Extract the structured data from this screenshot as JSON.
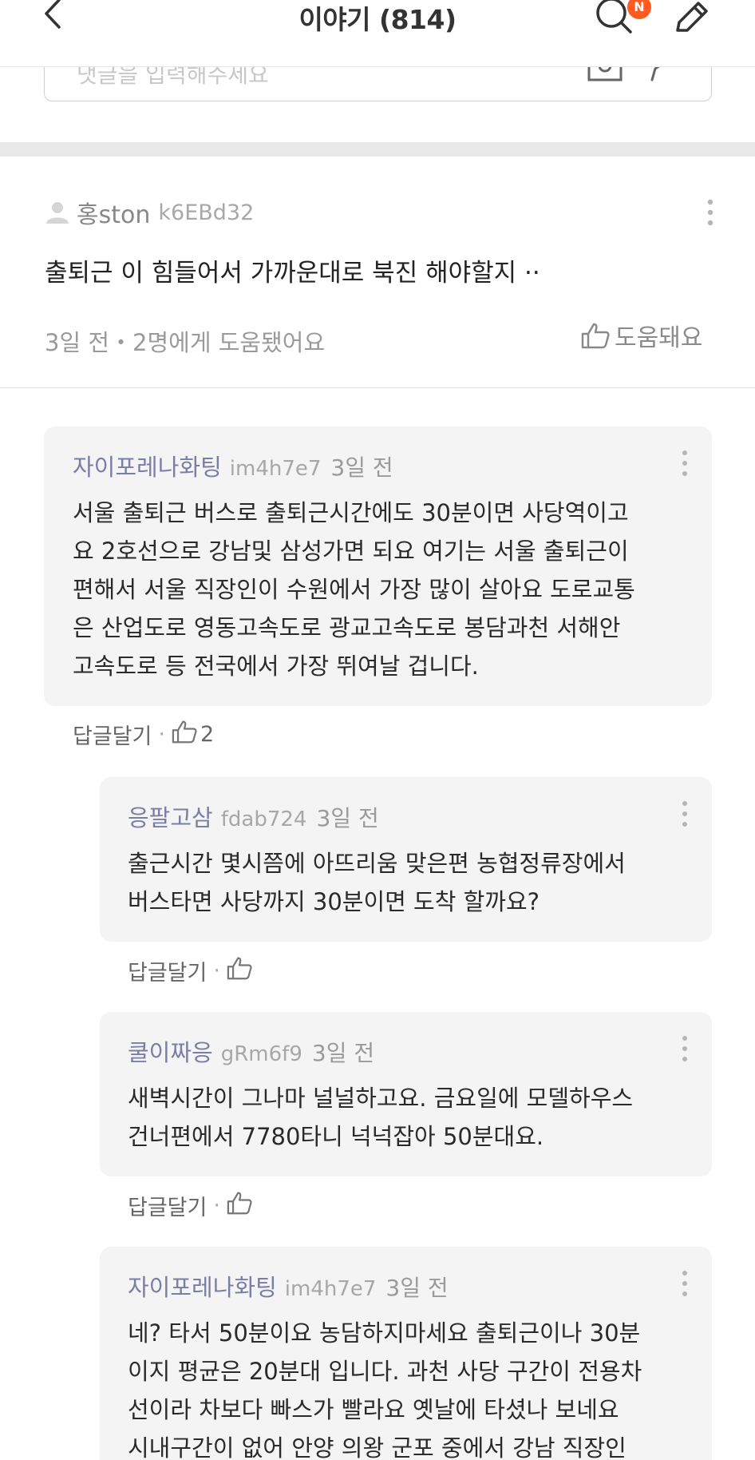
{
  "header": {
    "title": "이야기 (814)",
    "notification_badge": "N",
    "back_icon": "chevron-left-icon",
    "search_icon": "search-icon",
    "write_icon": "pencil-icon"
  },
  "comment_input": {
    "placeholder": "댓글을 입력해주세요"
  },
  "post": {
    "author": "홍ston",
    "user_id": "k6EBd32",
    "body": "출퇴근 이 힘들어서 가까운대로 북진 해야할지 ··",
    "footer": "3일 전・2명에게 도움됐어요",
    "helpful_label": "도움돼요"
  },
  "comments": [
    {
      "author": "자이포레나화팅",
      "user_id": "im4h7e7",
      "time": "3일 전",
      "lines": [
        "서울 출퇴근 버스로 출퇴근시간에도 30분이면 사당역이고",
        "요 2호선으로 강남및 삼성가면 되요 여기는 서울 출퇴근이",
        "편해서 서울 직장인이 수원에서 가장 많이 살아요 도로교통",
        "은 산업도로 영동고속도로 광교고속도로 봉담과천 서해안",
        "고속도로 등 전국에서 가장 뛰여날 겁니다."
      ],
      "reply_label": "답글달기",
      "likes": "2"
    },
    {
      "author": "응팔고삼",
      "user_id": "fdab724",
      "time": "3일 전",
      "lines": [
        "출근시간 몇시쯤에 아뜨리움 맞은편 농협정류장에서",
        "버스타면 사당까지 30분이면 도착 할까요?"
      ],
      "reply_label": "답글달기",
      "likes": ""
    },
    {
      "author": "쿨이짜응",
      "user_id": "gRm6f9",
      "time": "3일 전",
      "lines": [
        "새벽시간이 그나마 널널하고요. 금요일에 모델하우스",
        "건너편에서 7780타니 넉넉잡아 50분대요."
      ],
      "reply_label": "답글달기",
      "likes": ""
    },
    {
      "author": "자이포레나화팅",
      "user_id": "im4h7e7",
      "time": "3일 전",
      "lines": [
        "네? 타서 50분이요 농담하지마세요 출퇴근이나 30분",
        "이지 평균은 20분대 입니다. 과천 사당 구간이 전용차",
        "선이라 차보다 빠스가 빨라요 옛날에 타셨나 보네요",
        "시내구간이 없어 안양 의왕 군포 중에서  강남 직장인"
      ],
      "reply_label": "",
      "likes": ""
    }
  ]
}
